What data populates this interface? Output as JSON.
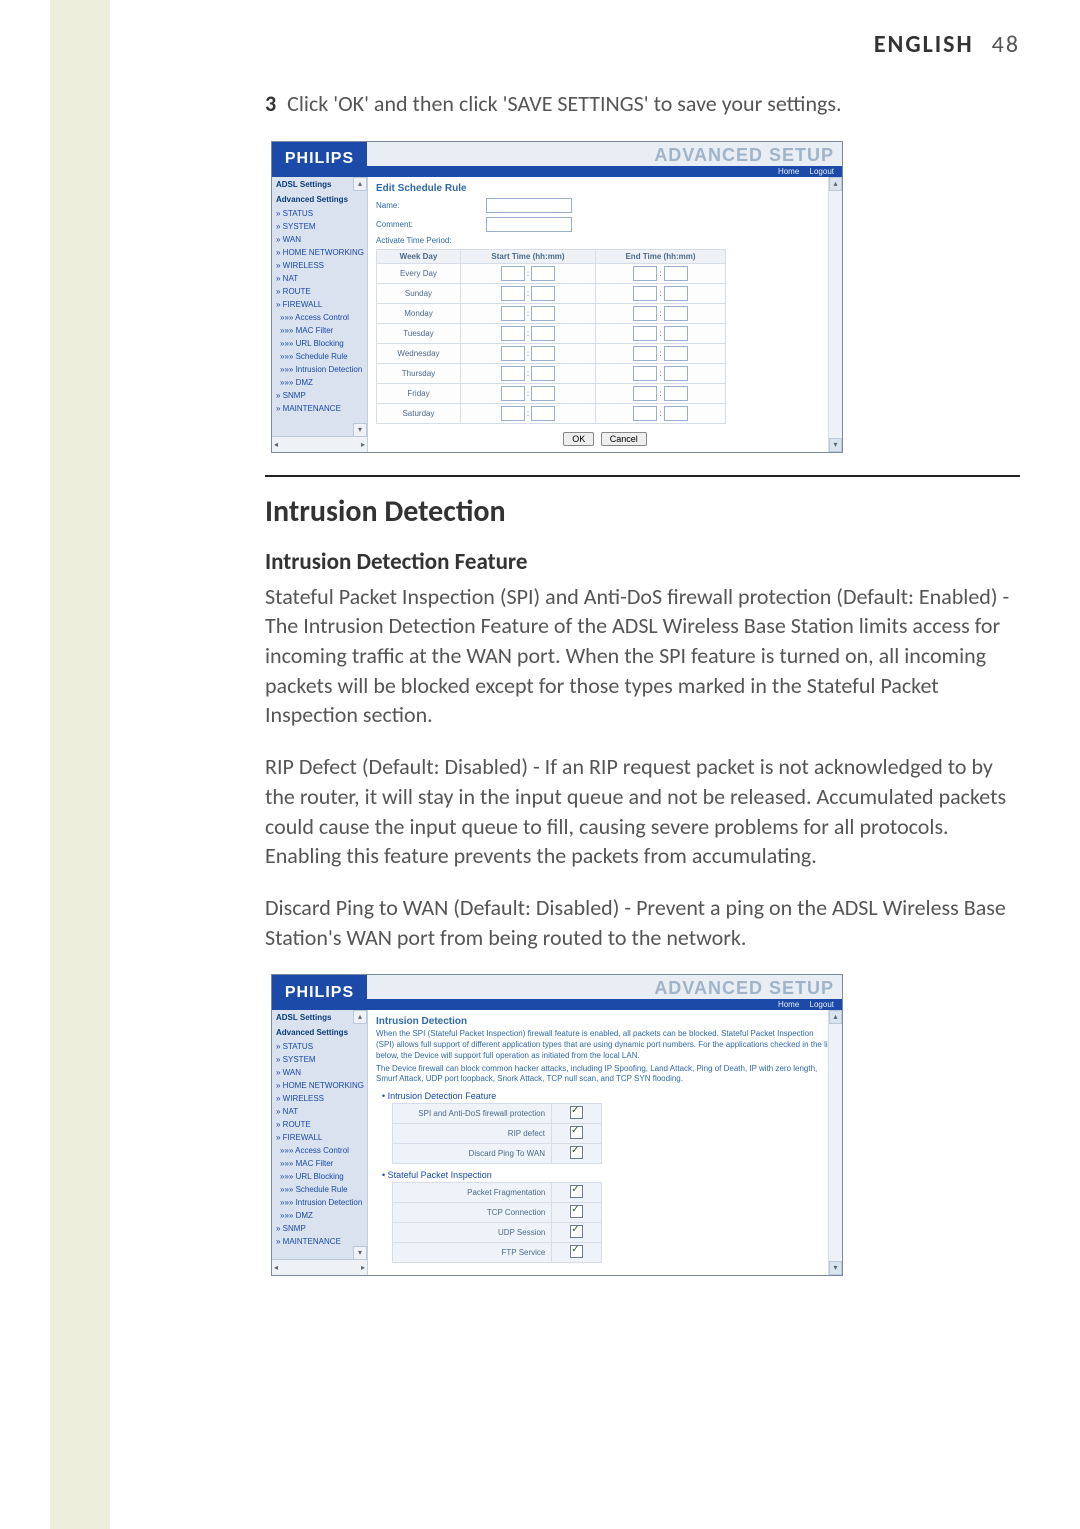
{
  "header": {
    "language": "ENGLISH",
    "page_number": "48"
  },
  "steps": {
    "num": "3",
    "text": "Click 'OK' and then click 'SAVE SETTINGS' to save your settings."
  },
  "section": {
    "title": "Intrusion Detection",
    "sub_title": "Intrusion Detection Feature",
    "p1": "Stateful Packet Inspection (SPI) and Anti-DoS firewall protection (Default: Enabled) - The Intrusion Detection Feature of the ADSL Wireless Base Station limits access for incoming traffic at the WAN port. When the SPI feature is turned on, all incoming packets will be blocked except for those types marked in the Stateful Packet Inspection section.",
    "p2": "RIP Defect (Default: Disabled) - If an RIP request packet is not acknowledged to by the router, it will stay in the input queue and not be released. Accumulated packets could cause the input queue to fill, causing severe problems for all protocols. Enabling this feature prevents the packets from accumulating.",
    "p3": "Discard Ping to WAN (Default: Disabled) - Prevent a ping on the ADSL Wireless Base Station's WAN port from being routed to the network."
  },
  "shot_common": {
    "brand": "PHILIPS",
    "banner": "ADVANCED SETUP",
    "home": "Home",
    "logout": "Logout"
  },
  "sidebar": {
    "adsl": "ADSL Settings",
    "adv": "Advanced Settings",
    "items": [
      "» STATUS",
      "» SYSTEM",
      "» WAN",
      "» HOME NETWORKING",
      "» WIRELESS",
      "» NAT",
      "» ROUTE",
      "» FIREWALL",
      "»»» Access Control",
      "»»» MAC Filter",
      "»»» URL Blocking",
      "»»» Schedule Rule",
      "»»» Intrusion Detection",
      "»»» DMZ",
      "» SNMP",
      "» MAINTENANCE"
    ]
  },
  "shot1": {
    "title": "Edit Schedule Rule",
    "name_lbl": "Name:",
    "comment_lbl": "Comment:",
    "period_lbl": "Activate Time Period:",
    "th_day": "Week Day",
    "th_start": "Start Time (hh:mm)",
    "th_end": "End Time (hh:mm)",
    "days": [
      "Every Day",
      "Sunday",
      "Monday",
      "Tuesday",
      "Wednesday",
      "Thursday",
      "Friday",
      "Saturday"
    ],
    "ok": "OK",
    "cancel": "Cancel"
  },
  "shot2": {
    "title": "Intrusion Detection",
    "intro1": "When the SPI (Stateful Packet Inspection) firewall feature is enabled, all packets can be blocked. Stateful Packet Inspection (SPI) allows full support of different application types that are using dynamic port numbers. For the applications checked in the list below, the Device will support full operation as initiated from the local LAN.",
    "intro2": "The Device firewall can block common hacker attacks, including IP Spoofing, Land Attack, Ping of Death, IP with zero length, Smurf Attack, UDP port loopback, Snork Attack, TCP null scan, and TCP SYN flooding.",
    "sub1": "• Intrusion Detection Feature",
    "t1": [
      {
        "label": "SPI and Anti-DoS firewall protection",
        "checked": true
      },
      {
        "label": "RIP defect",
        "checked": true
      },
      {
        "label": "Discard Ping To WAN",
        "checked": true
      }
    ],
    "sub2": "• Stateful Packet Inspection",
    "t2": [
      {
        "label": "Packet Fragmentation",
        "checked": true
      },
      {
        "label": "TCP Connection",
        "checked": true
      },
      {
        "label": "UDP Session",
        "checked": true
      },
      {
        "label": "FTP Service",
        "checked": true
      }
    ]
  }
}
